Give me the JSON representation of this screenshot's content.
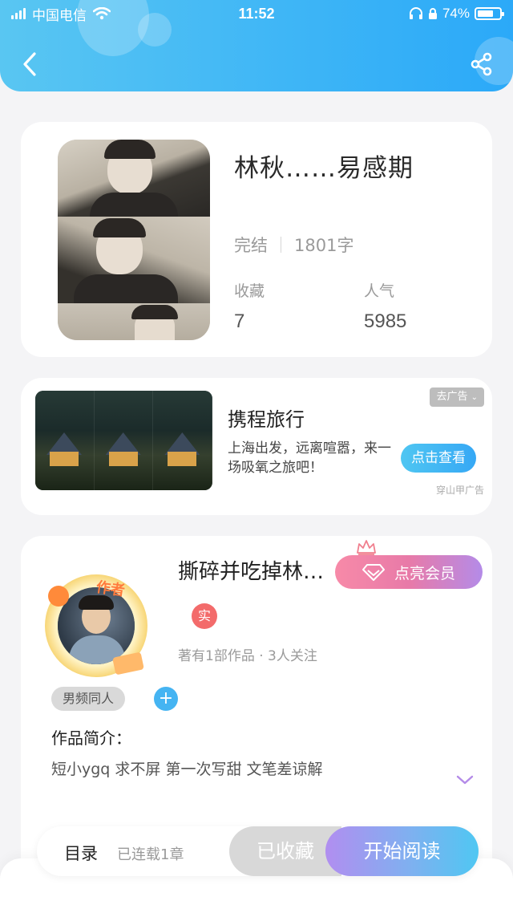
{
  "status_bar": {
    "carrier": "中国电信",
    "time": "11:52",
    "battery": "74%",
    "battery_level": 0.74
  },
  "header": {
    "back_icon": "chevron-left-icon",
    "share_icon": "share-icon"
  },
  "book": {
    "title": "林秋……易感期",
    "status": "完结",
    "word_count": "1801字",
    "favorites_label": "收藏",
    "favorites_value": "7",
    "popularity_label": "人气",
    "popularity_value": "5985"
  },
  "ad": {
    "title": "携程旅行",
    "description": "上海出发，远离喧嚣，来一场吸氧之旅吧！",
    "close_label": "去广告",
    "cta_label": "点击查看",
    "source": "穿山甲广告"
  },
  "author": {
    "name": "撕碎并吃掉林…",
    "avatar_tag": "作者",
    "vip_button": "点亮会员",
    "verified_badge": "实",
    "meta": "著有1部作品 · 3人关注",
    "tag": "男频同人",
    "intro_label": "作品简介：",
    "intro_text": "短小ygq 求不屏 第一次写甜 文笔差谅解"
  },
  "bottom_bar": {
    "toc_label": "目录",
    "toc_sub": "已连载1章",
    "favorited_label": "已收藏",
    "read_label": "开始阅读"
  },
  "colors": {
    "header_start": "#59c6f2",
    "header_end": "#2ba9f8",
    "accent_blue": "#45b4f2",
    "vip_pink": "#f78aa8",
    "vip_purple": "#b48be8",
    "badge_red": "#f36b6b"
  }
}
